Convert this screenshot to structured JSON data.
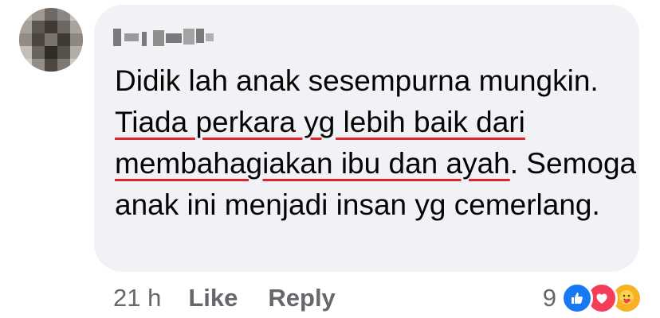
{
  "comment": {
    "author_name": "Ly· Lyndi",
    "text_before": "Didik lah anak sesempurna mungkin. ",
    "text_highlighted_1": "Tiada perkara yg lebih baik dari membahagiakan ibu dan ",
    "text_highlighted_2": "ayah",
    "text_after": ". Semoga anak ini menjadi insan yg cemerlang.",
    "underline_color": "#e0262a"
  },
  "meta": {
    "timestamp": "21 h",
    "like_label": "Like",
    "reply_label": "Reply"
  },
  "reactions": {
    "count": "9",
    "icons": [
      "like-icon",
      "love-icon",
      "care-icon"
    ],
    "colors": {
      "like": "#1877f2",
      "love": "#f33e58",
      "care": "#f7b125"
    }
  },
  "theme": {
    "bubble_bg": "#f0f2f5",
    "text_color": "#050505",
    "secondary_text": "#65676b"
  }
}
